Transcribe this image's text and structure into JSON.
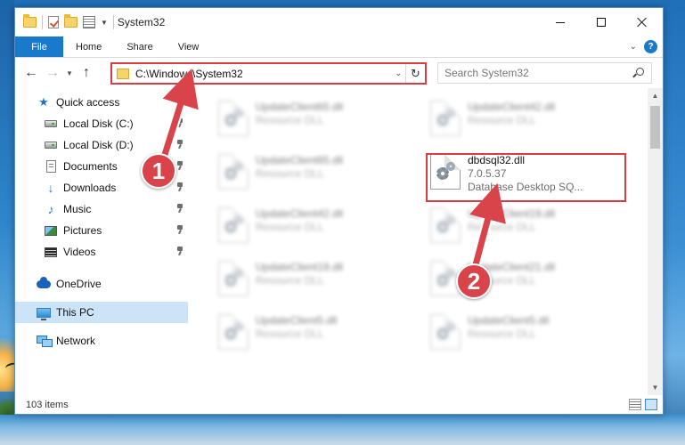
{
  "window": {
    "title": "System32"
  },
  "ribbon": {
    "tabs": [
      {
        "label": "File"
      },
      {
        "label": "Home"
      },
      {
        "label": "Share"
      },
      {
        "label": "View"
      }
    ],
    "help": "?"
  },
  "address": {
    "path": "C:\\Windows\\System32"
  },
  "search": {
    "placeholder": "Search System32"
  },
  "nav": {
    "items": [
      {
        "label": "Quick access",
        "icon": "star-icon"
      },
      {
        "label": "Local Disk (C:)",
        "icon": "disk-icon"
      },
      {
        "label": "Local Disk (D:)",
        "icon": "disk-icon"
      },
      {
        "label": "Documents",
        "icon": "document-icon"
      },
      {
        "label": "Downloads",
        "icon": "download-icon"
      },
      {
        "label": "Music",
        "icon": "music-icon"
      },
      {
        "label": "Pictures",
        "icon": "pictures-icon"
      },
      {
        "label": "Videos",
        "icon": "video-icon"
      },
      {
        "label": "OneDrive",
        "icon": "cloud-icon"
      },
      {
        "label": "This PC",
        "icon": "computer-icon"
      },
      {
        "label": "Network",
        "icon": "network-icon"
      }
    ]
  },
  "files": [
    {
      "name": "UpdateClient65.dll",
      "sub": "Resource DLL"
    },
    {
      "name": "UpdateClient42.dll",
      "sub": "Resource DLL"
    },
    {
      "name": "UpdateClient65.dll",
      "sub": "Resource DLL"
    },
    {
      "name": "dbdsql32.dll",
      "version": "7.0.5.37",
      "sub": "Database Desktop SQ..."
    },
    {
      "name": "UpdateClient42.dll",
      "sub": "Resource DLL"
    },
    {
      "name": "UpdateClient19.dll",
      "sub": "Resource DLL"
    },
    {
      "name": "UpdateClient19.dll",
      "sub": "Resource DLL"
    },
    {
      "name": "UpdateClient21.dll",
      "sub": "Resource DLL"
    },
    {
      "name": "UpdateClient5.dll",
      "sub": "Resource DLL"
    },
    {
      "name": "UpdateClient5.dll",
      "sub": "Resource DLL"
    }
  ],
  "status": {
    "count": "103 items"
  },
  "callouts": {
    "one": "1",
    "two": "2"
  },
  "colors": {
    "accent": "#1979ca",
    "callout": "#d9434a",
    "highlight_border": "#d63e44",
    "selection": "#cce4f7"
  }
}
